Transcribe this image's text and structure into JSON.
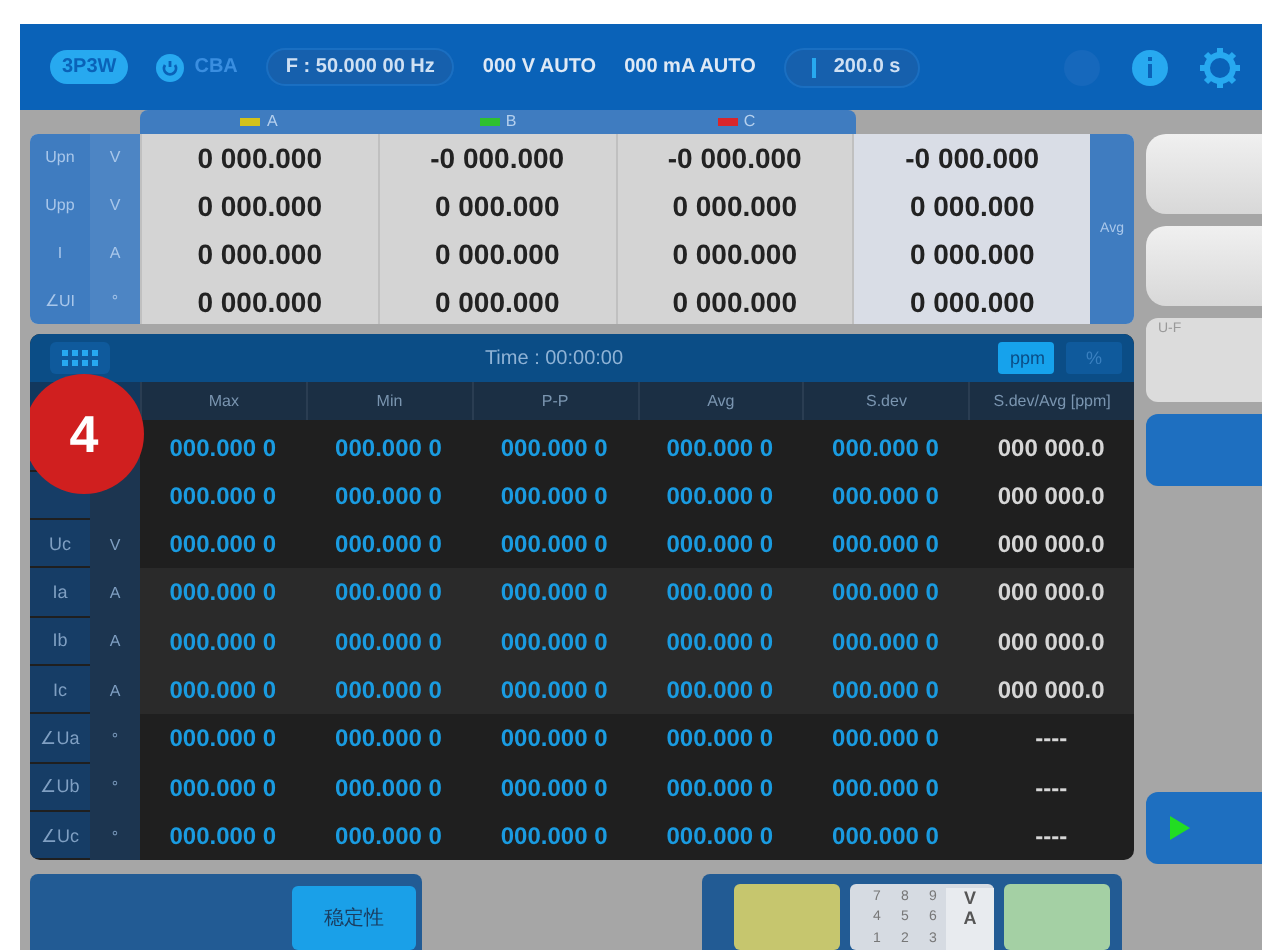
{
  "top_bar": {
    "wiring": "3P3W",
    "phase_order": "CBA",
    "frequency": "F : 50.000 00 Hz",
    "voltage_range": "000 V AUTO",
    "current_range": "000 mA AUTO",
    "duration": "200.0 s"
  },
  "phases": [
    {
      "label": "A",
      "color": "#d4c21a"
    },
    {
      "label": "B",
      "color": "#2ec02e"
    },
    {
      "label": "C",
      "color": "#d8262b"
    }
  ],
  "avg_label": "Avg",
  "live_rows": [
    {
      "label": "Upn",
      "unit": "V",
      "values": [
        "0 000.000",
        "-0 000.000",
        "-0 000.000",
        "-0 000.000"
      ]
    },
    {
      "label": "Upp",
      "unit": "V",
      "values": [
        "0 000.000",
        "0 000.000",
        "0 000.000",
        "0 000.000"
      ]
    },
    {
      "label": "I",
      "unit": "A",
      "values": [
        "0 000.000",
        "0 000.000",
        "0 000.000",
        "0 000.000"
      ]
    },
    {
      "label": "∠UI",
      "unit": "°",
      "values": [
        "0 000.000",
        "0 000.000",
        "0 000.000",
        "0 000.000"
      ]
    }
  ],
  "stats": {
    "time": "Time : 00:00:00",
    "toggles": [
      {
        "label": "ppm",
        "selected": true
      },
      {
        "label": "%",
        "selected": false
      }
    ],
    "columns": [
      "Max",
      "Min",
      "P-P",
      "Avg",
      "S.dev",
      "S.dev/Avg  [ppm]"
    ],
    "rows": [
      {
        "values": [
          "000.000 0",
          "000.000 0",
          "000.000 0",
          "000.000 0",
          "000.000 0",
          "000 000.0"
        ]
      },
      {
        "values": [
          "000.000 0",
          "000.000 0",
          "000.000 0",
          "000.000 0",
          "000.000 0",
          "000 000.0"
        ]
      },
      {
        "label": "Uc",
        "unit": "V",
        "values": [
          "000.000 0",
          "000.000 0",
          "000.000 0",
          "000.000 0",
          "000.000 0",
          "000 000.0"
        ]
      },
      {
        "label": "Ia",
        "unit": "A",
        "values": [
          "000.000 0",
          "000.000 0",
          "000.000 0",
          "000.000 0",
          "000.000 0",
          "000 000.0"
        ]
      },
      {
        "label": "Ib",
        "unit": "A",
        "values": [
          "000.000 0",
          "000.000 0",
          "000.000 0",
          "000.000 0",
          "000.000 0",
          "000 000.0"
        ]
      },
      {
        "label": "Ic",
        "unit": "A",
        "values": [
          "000.000 0",
          "000.000 0",
          "000.000 0",
          "000.000 0",
          "000.000 0",
          "000 000.0"
        ]
      },
      {
        "label": "∠Ua",
        "unit": "°",
        "values": [
          "000.000 0",
          "000.000 0",
          "000.000 0",
          "000.000 0",
          "000.000 0",
          "----"
        ]
      },
      {
        "label": "∠Ub",
        "unit": "°",
        "values": [
          "000.000 0",
          "000.000 0",
          "000.000 0",
          "000.000 0",
          "000.000 0",
          "----"
        ]
      },
      {
        "label": "∠Uc",
        "unit": "°",
        "values": [
          "000.000 0",
          "000.000 0",
          "000.000 0",
          "000.000 0",
          "000.000 0",
          "----"
        ]
      }
    ]
  },
  "step_badge": "4",
  "side_panel_label": "U-F",
  "stability_button": "稳定性",
  "keypad": {
    "digits": [
      "7",
      "8",
      "9",
      "4",
      "5",
      "6",
      "1",
      "2",
      "3"
    ],
    "units": [
      "V",
      "A"
    ]
  }
}
